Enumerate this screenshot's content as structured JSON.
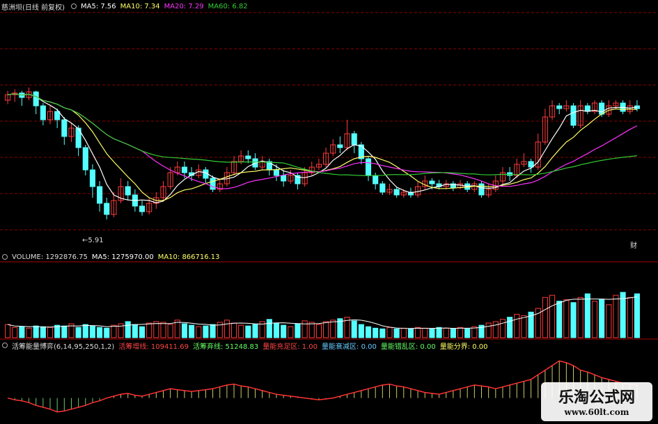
{
  "header": {
    "stock": "慈洲坝(日线 前复权)",
    "ma5": "MA5: 7.56",
    "ma10": "MA10: 7.34",
    "ma20": "MA20: 7.29",
    "ma60": "MA60: 6.82"
  },
  "price_panel": {
    "low_label": "←5.91",
    "corner_tag": "财"
  },
  "volume_header": {
    "volume": "VOLUME: 1292876.75",
    "ma5": "MA5: 1275970.00",
    "ma10": "MA10: 866716.13"
  },
  "indicator_header": {
    "name": "活筹能量博弈(6,14,95,250,1,2)",
    "item1": "活筹增线: 109411.69",
    "item2": "活筹弃线: 51248.83",
    "item3": "量能充足区: 1.00",
    "item4": "量能衰减区: 0.00",
    "item5": "量能错乱区: 0.00",
    "item6": "量能分界: 0.00"
  },
  "watermark": {
    "title": "乐淘公式网",
    "url": "www.60lt.com"
  },
  "colors": {
    "up": "#ff3b3b",
    "down": "#54ffff",
    "ma5": "#ffffff",
    "ma10": "#ffff66",
    "ma20": "#ff33ff",
    "ma60": "#33cc33",
    "grid": "#8b0000"
  },
  "chart_data": {
    "type": "candlestick",
    "ylim": [
      5.6,
      8.6
    ],
    "candles": [
      [
        8.05,
        8.15,
        8.22,
        7.98
      ],
      [
        8.15,
        8.18,
        8.25,
        8.02
      ],
      [
        8.18,
        8.1,
        8.22,
        7.95
      ],
      [
        8.1,
        8.2,
        8.28,
        8.05
      ],
      [
        8.2,
        7.95,
        8.22,
        7.8
      ],
      [
        7.95,
        7.7,
        8.0,
        7.6
      ],
      [
        7.7,
        7.85,
        7.95,
        7.62
      ],
      [
        7.85,
        7.7,
        7.9,
        7.55
      ],
      [
        7.7,
        7.4,
        7.75,
        7.25
      ],
      [
        7.4,
        7.55,
        7.65,
        7.3
      ],
      [
        7.55,
        7.2,
        7.6,
        7.05
      ],
      [
        7.2,
        6.8,
        7.25,
        6.7
      ],
      [
        6.8,
        6.5,
        6.9,
        6.3
      ],
      [
        6.5,
        6.2,
        6.6,
        6.05
      ],
      [
        6.2,
        6.0,
        6.3,
        5.91
      ],
      [
        6.0,
        6.25,
        6.4,
        5.95
      ],
      [
        6.25,
        6.5,
        6.65,
        6.2
      ],
      [
        6.5,
        6.35,
        6.6,
        6.25
      ],
      [
        6.35,
        6.15,
        6.45,
        6.05
      ],
      [
        6.15,
        6.05,
        6.25,
        5.98
      ],
      [
        6.05,
        6.2,
        6.3,
        6.0
      ],
      [
        6.2,
        6.3,
        6.4,
        6.1
      ],
      [
        6.3,
        6.5,
        6.6,
        6.25
      ],
      [
        6.5,
        6.75,
        6.85,
        6.45
      ],
      [
        6.75,
        6.85,
        6.95,
        6.7
      ],
      [
        6.85,
        6.75,
        6.95,
        6.65
      ],
      [
        6.75,
        6.7,
        6.85,
        6.6
      ],
      [
        6.7,
        6.8,
        6.9,
        6.65
      ],
      [
        6.8,
        6.65,
        6.85,
        6.55
      ],
      [
        6.65,
        6.45,
        6.7,
        6.4
      ],
      [
        6.45,
        6.55,
        6.65,
        6.4
      ],
      [
        6.55,
        6.75,
        6.85,
        6.5
      ],
      [
        6.75,
        6.95,
        7.05,
        6.7
      ],
      [
        6.95,
        7.05,
        7.15,
        6.9
      ],
      [
        7.05,
        7.0,
        7.15,
        6.92
      ],
      [
        7.0,
        6.85,
        7.1,
        6.8
      ],
      [
        6.85,
        6.95,
        7.05,
        6.8
      ],
      [
        6.95,
        6.8,
        7.0,
        6.7
      ],
      [
        6.8,
        6.7,
        6.9,
        6.6
      ],
      [
        6.7,
        6.6,
        6.8,
        6.5
      ],
      [
        6.6,
        6.7,
        6.8,
        6.55
      ],
      [
        6.7,
        6.55,
        6.75,
        6.45
      ],
      [
        6.55,
        6.75,
        6.85,
        6.5
      ],
      [
        6.75,
        6.85,
        6.95,
        6.7
      ],
      [
        6.85,
        6.9,
        7.0,
        6.8
      ],
      [
        6.9,
        7.1,
        7.2,
        6.85
      ],
      [
        7.1,
        7.25,
        7.35,
        7.05
      ],
      [
        7.25,
        7.2,
        7.4,
        7.1
      ],
      [
        7.2,
        7.45,
        7.7,
        7.15
      ],
      [
        7.45,
        7.25,
        7.5,
        7.1
      ],
      [
        7.25,
        7.0,
        7.3,
        6.9
      ],
      [
        7.0,
        6.7,
        7.05,
        6.6
      ],
      [
        6.7,
        6.55,
        6.75,
        6.45
      ],
      [
        6.55,
        6.4,
        6.6,
        6.35
      ],
      [
        6.4,
        6.45,
        6.55,
        6.35
      ],
      [
        6.45,
        6.35,
        6.5,
        6.3
      ],
      [
        6.35,
        6.4,
        6.45,
        6.3
      ],
      [
        6.4,
        6.35,
        6.48,
        6.3
      ],
      [
        6.35,
        6.5,
        6.6,
        6.3
      ],
      [
        6.5,
        6.6,
        6.7,
        6.45
      ],
      [
        6.6,
        6.55,
        6.65,
        6.45
      ],
      [
        6.55,
        6.5,
        6.62,
        6.45
      ],
      [
        6.5,
        6.55,
        6.62,
        6.45
      ],
      [
        6.55,
        6.48,
        6.6,
        6.42
      ],
      [
        6.48,
        6.55,
        6.62,
        6.45
      ],
      [
        6.55,
        6.45,
        6.6,
        6.4
      ],
      [
        6.45,
        6.55,
        6.6,
        6.4
      ],
      [
        6.55,
        6.35,
        6.6,
        6.3
      ],
      [
        6.35,
        6.45,
        6.55,
        6.3
      ],
      [
        6.45,
        6.6,
        6.7,
        6.4
      ],
      [
        6.6,
        6.75,
        6.85,
        6.55
      ],
      [
        6.75,
        6.7,
        6.85,
        6.6
      ],
      [
        6.7,
        6.9,
        7.0,
        6.65
      ],
      [
        6.9,
        6.95,
        7.1,
        6.85
      ],
      [
        6.95,
        6.85,
        7.0,
        6.75
      ],
      [
        6.85,
        7.3,
        7.45,
        6.8
      ],
      [
        7.3,
        7.75,
        7.9,
        7.25
      ],
      [
        7.75,
        7.95,
        8.05,
        7.7
      ],
      [
        7.95,
        7.9,
        8.0,
        7.8
      ],
      [
        7.9,
        7.95,
        8.05,
        7.85
      ],
      [
        7.95,
        7.6,
        8.0,
        7.55
      ],
      [
        7.6,
        7.95,
        8.05,
        7.55
      ],
      [
        7.95,
        7.85,
        8.0,
        7.8
      ],
      [
        7.85,
        8.0,
        8.05,
        7.8
      ],
      [
        8.0,
        7.8,
        8.05,
        7.75
      ],
      [
        7.8,
        7.95,
        8.05,
        7.75
      ],
      [
        7.95,
        8.0,
        8.05,
        7.9
      ],
      [
        8.0,
        7.85,
        8.05,
        7.8
      ],
      [
        7.85,
        7.95,
        8.05,
        7.8
      ],
      [
        7.95,
        7.9,
        8.05,
        7.85
      ]
    ],
    "volume": [
      18,
      14,
      15,
      13,
      16,
      15,
      14,
      17,
      16,
      19,
      14,
      18,
      16,
      14,
      13,
      17,
      19,
      22,
      18,
      15,
      20,
      22,
      21,
      18,
      24,
      19,
      17,
      15,
      16,
      18,
      21,
      24,
      20,
      17,
      16,
      18,
      22,
      25,
      20,
      17,
      15,
      19,
      23,
      21,
      18,
      22,
      24,
      26,
      28,
      23,
      18,
      15,
      13,
      12,
      14,
      12,
      13,
      12,
      14,
      13,
      12,
      14,
      13,
      12,
      14,
      12,
      15,
      17,
      20,
      22,
      25,
      28,
      32,
      30,
      35,
      40,
      55,
      58,
      50,
      52,
      48,
      55,
      60,
      50,
      52,
      45,
      58,
      62,
      55,
      60
    ],
    "volume_ylim": [
      0,
      100
    ],
    "indicator": [
      0,
      -2,
      -3,
      -5,
      -8,
      -10,
      -12,
      -15,
      -14,
      -12,
      -10,
      -8,
      -5,
      -3,
      0,
      2,
      4,
      5,
      3,
      2,
      4,
      6,
      8,
      10,
      9,
      8,
      7,
      8,
      9,
      10,
      12,
      14,
      15,
      13,
      12,
      10,
      8,
      6,
      4,
      3,
      2,
      1,
      0,
      -1,
      -2,
      -1,
      0,
      2,
      4,
      6,
      8,
      10,
      12,
      14,
      15,
      13,
      12,
      10,
      8,
      6,
      5,
      4,
      6,
      8,
      10,
      12,
      14,
      13,
      12,
      10,
      12,
      14,
      16,
      18,
      20,
      25,
      30,
      35,
      40,
      38,
      35,
      30,
      28,
      25,
      22,
      20,
      18,
      16,
      15,
      14
    ],
    "indicator_ylim": [
      -25,
      50
    ]
  }
}
